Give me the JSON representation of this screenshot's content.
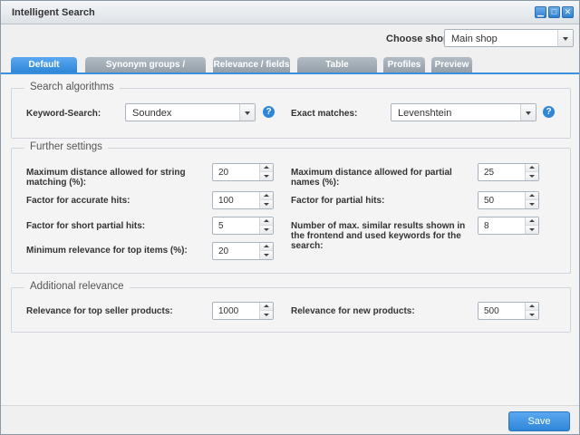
{
  "window": {
    "title": "Intelligent Search",
    "controls": [
      "minimize",
      "maximize",
      "close"
    ]
  },
  "shop": {
    "label": "Choose shop:",
    "value": "Main shop"
  },
  "tabs": [
    {
      "label": "Default settings",
      "active": true
    },
    {
      "label": "Synonym groups / promotions"
    },
    {
      "label": "Relevance / fields"
    },
    {
      "label": "Table configuration"
    },
    {
      "label": "Profiles"
    },
    {
      "label": "Preview"
    }
  ],
  "search_algorithms": {
    "legend": "Search algorithms",
    "keyword_label": "Keyword-Search:",
    "keyword_value": "Soundex",
    "exact_label": "Exact matches:",
    "exact_value": "Levenshtein",
    "help_glyph": "?"
  },
  "further_settings": {
    "legend": "Further settings",
    "max_distance_string": {
      "label": "Maximum distance allowed for string matching (%):",
      "value": "20"
    },
    "factor_accurate": {
      "label": "Factor for accurate hits:",
      "value": "100"
    },
    "factor_short_partial": {
      "label": "Factor for short partial hits:",
      "value": "5"
    },
    "min_relevance_top": {
      "label": "Minimum relevance for top items (%):",
      "value": "20"
    },
    "max_distance_partial": {
      "label": "Maximum distance allowed for partial names (%):",
      "value": "25"
    },
    "factor_partial": {
      "label": "Factor for partial hits:",
      "value": "50"
    },
    "max_similar_results": {
      "label": "Number of max. similar results shown in the frontend and used keywords for the search:",
      "value": "8"
    }
  },
  "additional_relevance": {
    "legend": "Additional relevance",
    "top_seller": {
      "label": "Relevance for top seller products:",
      "value": "1000"
    },
    "new_products": {
      "label": "Relevance for new products:",
      "value": "500"
    }
  },
  "footer": {
    "save_label": "Save"
  },
  "colors": {
    "accent": "#2f86d8",
    "tab_inactive": "#a3adb7"
  }
}
